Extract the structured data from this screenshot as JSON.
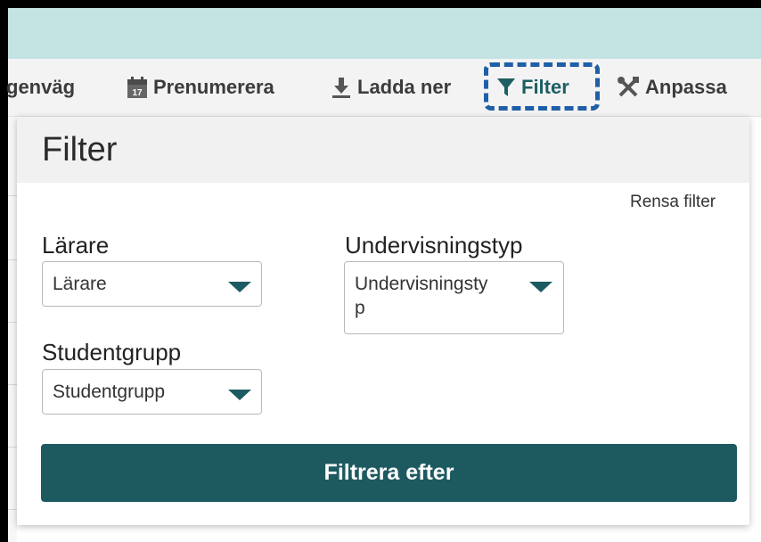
{
  "toolbar": {
    "shortcut_label": "genväg",
    "subscribe_label": "Prenumerera",
    "download_label": "Ladda ner",
    "filter_label": "Filter",
    "customize_label": "Anpassa"
  },
  "panel": {
    "title": "Filter",
    "clear_label": "Rensa filter",
    "fields": {
      "teacher": {
        "label": "Lärare",
        "value": "Lärare"
      },
      "teaching_type": {
        "label": "Undervisningstyp",
        "value": "Undervisningsty\np"
      },
      "student_group": {
        "label": "Studentgrupp",
        "value": "Studentgrupp"
      }
    },
    "submit_label": "Filtrera efter"
  },
  "calendar_icon_day": "17",
  "colors": {
    "top_bar": "#c4e3e3",
    "accent": "#1d5a60",
    "highlight": "#1f5fa8"
  }
}
